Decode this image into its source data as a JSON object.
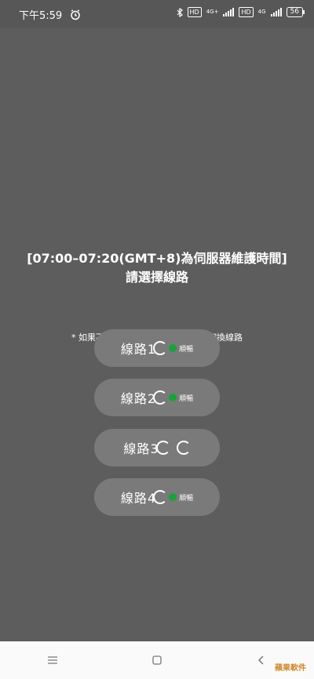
{
  "status_bar": {
    "time": "下午5:59",
    "alarm_icon": "alarm-clock-icon",
    "sim1_type": "4G+",
    "sim2_type": "4G",
    "hd_label": "HD",
    "battery": "56"
  },
  "main": {
    "title_line1": "[07:00–07:20(GMT+8)為伺服器維護時間]",
    "title_line2": "請選擇線路",
    "note": "* 如果不能連接或不能載圖，請嘗試切換線路",
    "routes": [
      {
        "label": "線路1",
        "status": "順暢",
        "ok": true
      },
      {
        "label": "線路2",
        "status": "順暢",
        "ok": true
      },
      {
        "label": "線路3",
        "status": "",
        "ok": false
      },
      {
        "label": "線路4",
        "status": "順暢",
        "ok": true
      }
    ]
  },
  "nav_bar": {
    "items": [
      "menu-icon",
      "home-square-icon",
      "back-icon"
    ]
  },
  "watermark": "蘋果軟件"
}
